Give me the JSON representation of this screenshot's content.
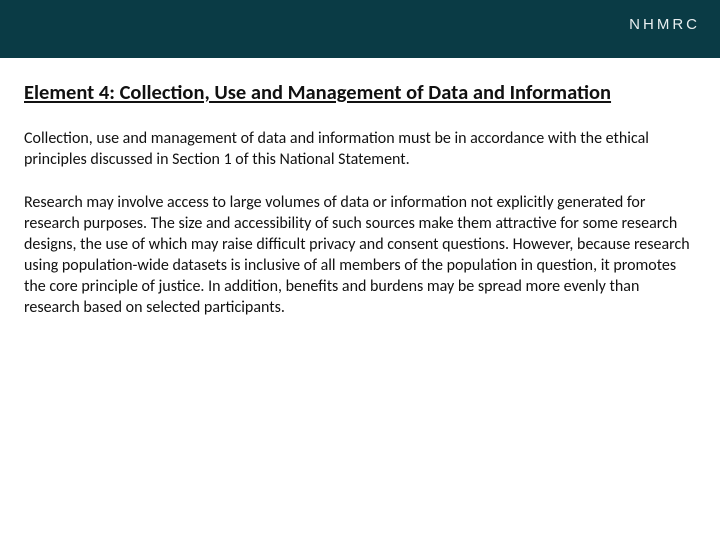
{
  "banner": {
    "brand": "NHMRC"
  },
  "heading": "Element 4: Collection, Use and Management of Data and Information",
  "paragraphs": [
    "Collection, use and management of data and information must be in accordance with the ethical principles discussed in Section 1 of this National Statement.",
    "Research may involve access to large volumes of data or information not explicitly generated for research purposes. The size and accessibility of such sources make them attractive for some research designs, the use of which may raise difficult privacy and consent questions. However, because research using population-wide datasets is inclusive of all members of the population in question, it promotes the core principle of justice. In addition, benefits and burdens may be spread more evenly than research based on selected participants."
  ]
}
